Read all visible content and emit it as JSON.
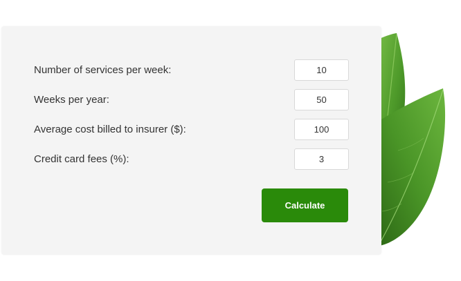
{
  "calculator": {
    "fields": [
      {
        "label": "Number of services per week:",
        "value": "10"
      },
      {
        "label": "Weeks per year:",
        "value": "50"
      },
      {
        "label": "Average cost billed to insurer ($):",
        "value": "100"
      },
      {
        "label": "Credit card fees (%):",
        "value": "3"
      }
    ],
    "calculate_label": "Calculate"
  },
  "colors": {
    "panel_background": "#f4f4f4",
    "button_green": "#2a8a0a",
    "leaf_green": "#4d9a2b"
  },
  "icons": [
    "leaf-illustration"
  ]
}
